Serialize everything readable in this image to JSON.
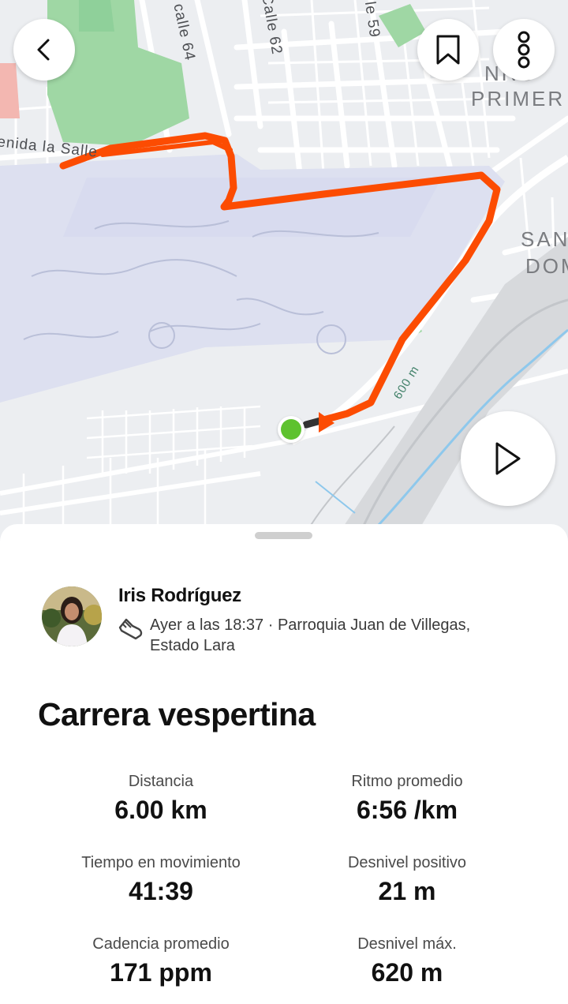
{
  "map": {
    "street_labels": [
      "enida la Salle",
      "calle 64",
      "Calle 62",
      "le 59",
      "600 m"
    ],
    "area_labels": [
      "NRO",
      "PRIMER",
      "SAN",
      "DOMI"
    ]
  },
  "header": {
    "back_label": "Back",
    "bookmark_label": "Save",
    "more_label": "More options"
  },
  "activity": {
    "athlete_name": "Iris Rodríguez",
    "activity_type_icon": "running-shoe-icon",
    "meta_line1": "Ayer a las 18:37 · Parroquia Juan de Villegas,",
    "meta_line2": "Estado Lara",
    "title": "Carrera vespertina"
  },
  "stats": [
    {
      "label": "Distancia",
      "value": "6.00 km"
    },
    {
      "label": "Ritmo promedio",
      "value": "6:56 /km"
    },
    {
      "label": "Tiempo en movimiento",
      "value": "41:39"
    },
    {
      "label": "Desnivel positivo",
      "value": "21 m"
    },
    {
      "label": "Cadencia promedio",
      "value": "171 ppm"
    },
    {
      "label": "Desnivel máx.",
      "value": "620 m"
    }
  ],
  "colors": {
    "route": "#fc4c02",
    "start_dot": "#5ec22f",
    "park": "#9fd7a4",
    "airport": "#dde0f0",
    "water": "#8ec8ec"
  }
}
